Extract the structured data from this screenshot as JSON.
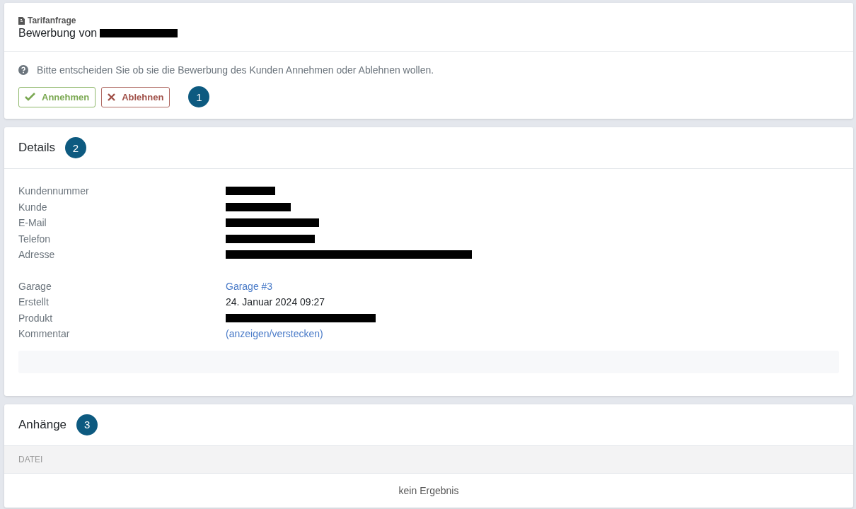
{
  "header": {
    "category": "Tarifanfrage",
    "title": "Bewerbung von",
    "title_redacted": true
  },
  "prompt": {
    "text": "Bitte entscheiden Sie ob sie die Bewerbung des Kunden Annehmen oder Ablehnen wollen."
  },
  "actions": [
    {
      "label": "Annehmen",
      "kind": "accept"
    },
    {
      "label": "Ablehnen",
      "kind": "reject"
    }
  ],
  "actions_badge": "1",
  "details": {
    "title": "Details",
    "badge": "2",
    "groups": [
      [
        {
          "label": "Kundennummer",
          "kind": "redacted"
        },
        {
          "label": "Kunde",
          "kind": "redacted"
        },
        {
          "label": "E-Mail",
          "kind": "redacted"
        },
        {
          "label": "Telefon",
          "kind": "redacted"
        },
        {
          "label": "Adresse",
          "kind": "redacted"
        }
      ],
      [
        {
          "label": "Garage",
          "kind": "link",
          "value": "Garage #3"
        },
        {
          "label": "Erstellt",
          "kind": "text",
          "value": "24. Januar 2024 09:27"
        },
        {
          "label": "Produkt",
          "kind": "redacted"
        },
        {
          "label": "Kommentar",
          "kind": "link",
          "value": "(anzeigen/verstecken)"
        }
      ]
    ],
    "comment_box": true
  },
  "attachments": {
    "title": "Anhänge",
    "badge": "3",
    "columns": [
      "DATEI"
    ],
    "empty": "kein Ergebnis"
  }
}
